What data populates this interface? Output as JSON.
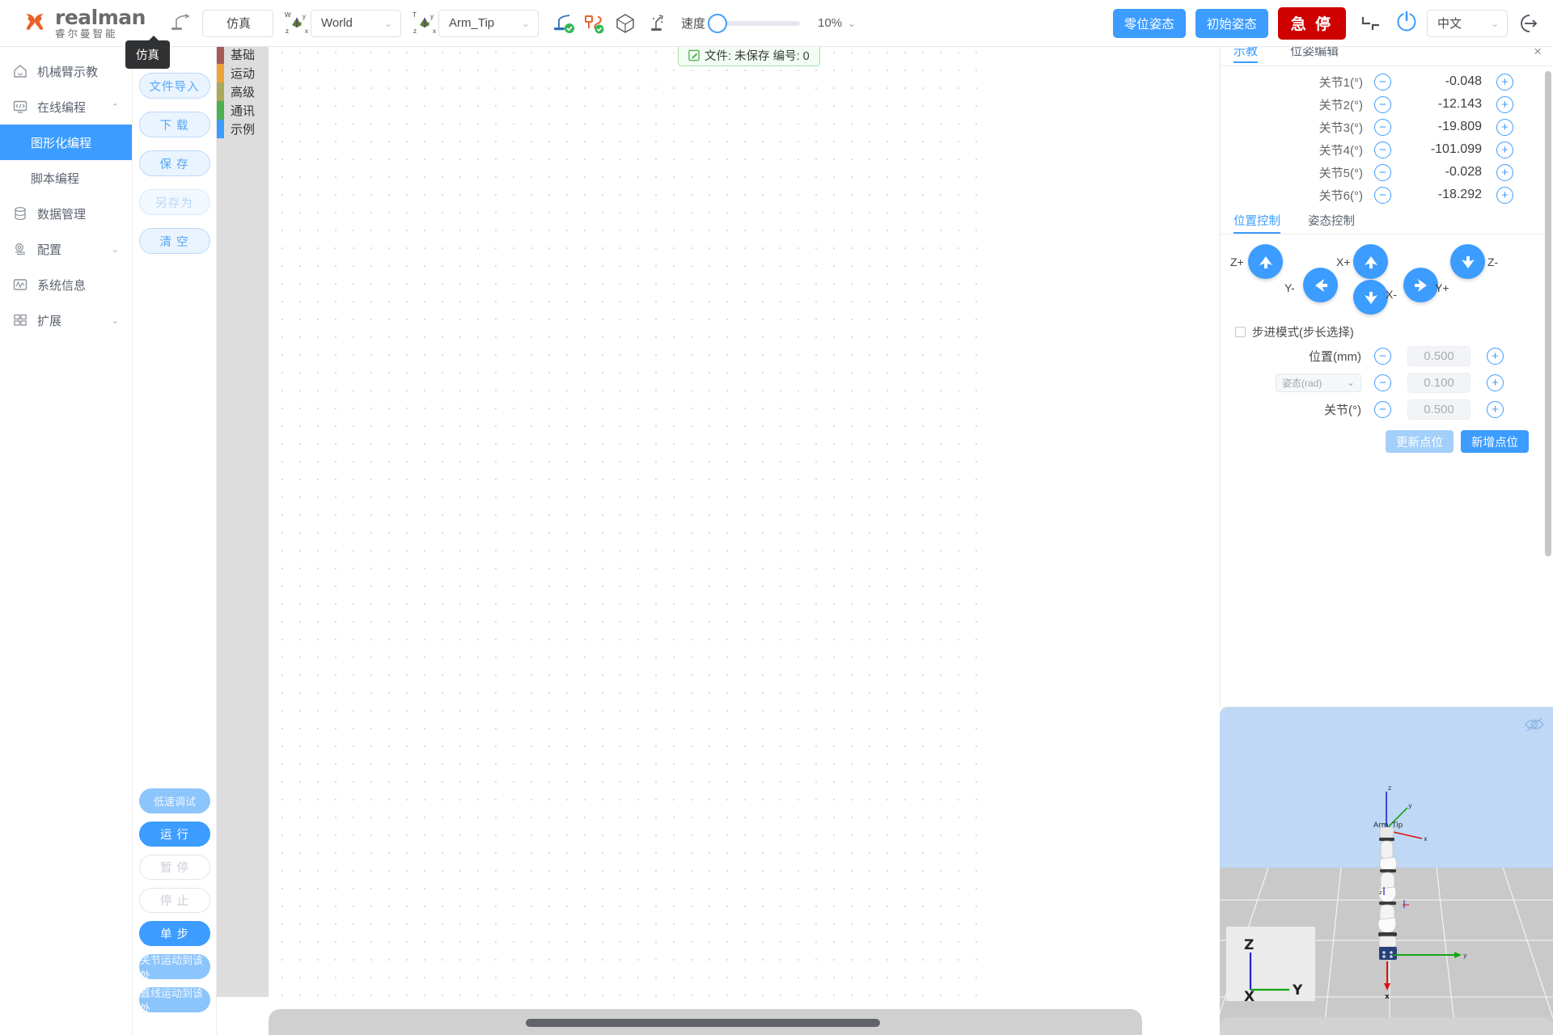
{
  "app": {
    "brand_en": "realman",
    "brand_cn": "睿尔曼智能",
    "accent": "#3c9cff",
    "danger": "#cf0000"
  },
  "topbar": {
    "sim_tooltip": "仿真",
    "sim_button": "仿真",
    "frame_select": {
      "value": "World",
      "label_w": "W",
      "label_y": "y",
      "label_z": "z",
      "label_x": "x"
    },
    "tip_select": {
      "value": "Arm_Tip",
      "label_t": "T",
      "label_y": "y",
      "label_z": "z",
      "label_x": "x"
    },
    "speed_label": "速度",
    "speed_value": "10%",
    "zero_pose_button": "零位姿态",
    "init_pose_button": "初始姿态",
    "estop_button": "急 停",
    "language": "中文"
  },
  "sidebar": {
    "items": [
      {
        "label": "机械臂示教",
        "icon": "home-icon",
        "expandable": false
      },
      {
        "label": "在线编程",
        "icon": "code-monitor-icon",
        "expandable": true,
        "expanded": true
      },
      {
        "label": "数据管理",
        "icon": "database-icon",
        "expandable": false
      },
      {
        "label": "配置",
        "icon": "gear-icon",
        "expandable": true,
        "expanded": false
      },
      {
        "label": "系统信息",
        "icon": "chart-monitor-icon",
        "expandable": false
      },
      {
        "label": "扩展",
        "icon": "grid-icon",
        "expandable": true,
        "expanded": false
      }
    ],
    "sub_items": [
      {
        "label": "图形化编程",
        "active": true
      },
      {
        "label": "脚本编程",
        "active": false
      }
    ]
  },
  "program_panel": {
    "buttons": [
      {
        "label": "文件导入",
        "disabled": false
      },
      {
        "label": "下 载",
        "disabled": false
      },
      {
        "label": "保 存",
        "disabled": false
      },
      {
        "label": "另存为",
        "disabled": true
      },
      {
        "label": "清 空",
        "disabled": false
      }
    ],
    "bottom_buttons": [
      {
        "label": "低速调试",
        "style": "pale"
      },
      {
        "label": "运 行",
        "style": "solid"
      },
      {
        "label": "暂 停",
        "style": "ghost"
      },
      {
        "label": "停 止",
        "style": "ghost"
      },
      {
        "label": "单 步",
        "style": "solid"
      },
      {
        "label": "关节运动到该处",
        "style": "pale"
      },
      {
        "label": "直线运动到该处",
        "style": "pale"
      }
    ]
  },
  "toolbox": {
    "categories": [
      {
        "label": "基础",
        "color": "#a55b5b"
      },
      {
        "label": "运动",
        "color": "#eda33b"
      },
      {
        "label": "高级",
        "color": "#a9a95e"
      },
      {
        "label": "通讯",
        "color": "#4caf50"
      },
      {
        "label": "示例",
        "color": "#3c9cff"
      }
    ]
  },
  "canvas": {
    "file_status": "文件: 未保存  编号: 0",
    "file_icon": "edit-square-icon"
  },
  "right_panel": {
    "tabs": [
      {
        "label": "示教",
        "active": true
      },
      {
        "label": "位姿编辑",
        "active": false
      }
    ],
    "close_label": "×",
    "joints": [
      {
        "label": "关节1(°)",
        "value": "-0.048"
      },
      {
        "label": "关节2(°)",
        "value": "-12.143"
      },
      {
        "label": "关节3(°)",
        "value": "-19.809"
      },
      {
        "label": "关节4(°)",
        "value": "-101.099"
      },
      {
        "label": "关节5(°)",
        "value": "-0.028"
      },
      {
        "label": "关节6(°)",
        "value": "-18.292"
      }
    ],
    "control_tabs": [
      {
        "label": "位置控制",
        "active": true
      },
      {
        "label": "姿态控制",
        "active": false
      }
    ],
    "dpad": [
      {
        "label": "Z+",
        "dir": "up"
      },
      {
        "label": "Y-",
        "dir": "left"
      },
      {
        "label": "X+",
        "dir": "up"
      },
      {
        "label": "X-",
        "dir": "down"
      },
      {
        "label": "Y+",
        "dir": "right"
      },
      {
        "label": "Z-",
        "dir": "down"
      }
    ],
    "step_mode_label": "步进模式(步长选择)",
    "step_mode_checked": false,
    "steps": [
      {
        "label": "位置(mm)",
        "value": "0.500",
        "type": "label"
      },
      {
        "label": "姿态(rad)",
        "value": "0.100",
        "type": "select"
      },
      {
        "label": "关节(°)",
        "value": "0.500",
        "type": "label"
      }
    ],
    "update_point_button": "更新点位",
    "add_point_button": "新增点位"
  },
  "view3d": {
    "tip_label": "Arm_Tip",
    "axis_gizmo": {
      "z": "Z",
      "y": "Y",
      "x": "X"
    },
    "world_axes": {
      "z": "z",
      "y": "y",
      "x": "x"
    },
    "eye_icon": "eye-off-icon"
  }
}
